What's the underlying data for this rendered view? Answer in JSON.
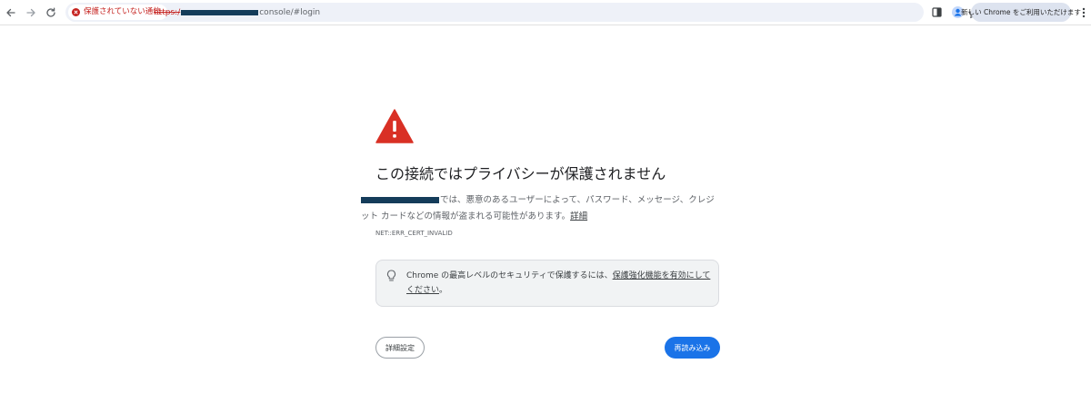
{
  "toolbar": {
    "security_chip": "保護されていない通信",
    "url_scheme": "https:/",
    "url_path": "console/#login",
    "promo_label": "新しい Chrome をご利用いただけます",
    "icons": [
      "back-arrow-icon",
      "forward-arrow-icon",
      "reload-icon",
      "star-icon",
      "side-panel-icon",
      "profile-icon",
      "menu-dots-icon"
    ]
  },
  "interstitial": {
    "heading": "この接続ではプライバシーが保護されません",
    "explanation": "では、悪意のあるユーザーによって、パスワード、メッセージ、クレジット カードなどの情報が盗まれる可能性があります。",
    "details_link": "詳細",
    "error_code": "NET::ERR_CERT_INVALID",
    "enhanced_prefix": "Chrome の最高レベルのセキュリティで保護するには、",
    "enhanced_link": "保護強化機能を有効にしてください",
    "enhanced_suffix": "。",
    "details_button": "詳細設定",
    "reload_button": "再読み込み"
  },
  "colors": {
    "warning_red": "#d93025",
    "primary_blue": "#1a73e8",
    "redaction": "#143c5a"
  }
}
